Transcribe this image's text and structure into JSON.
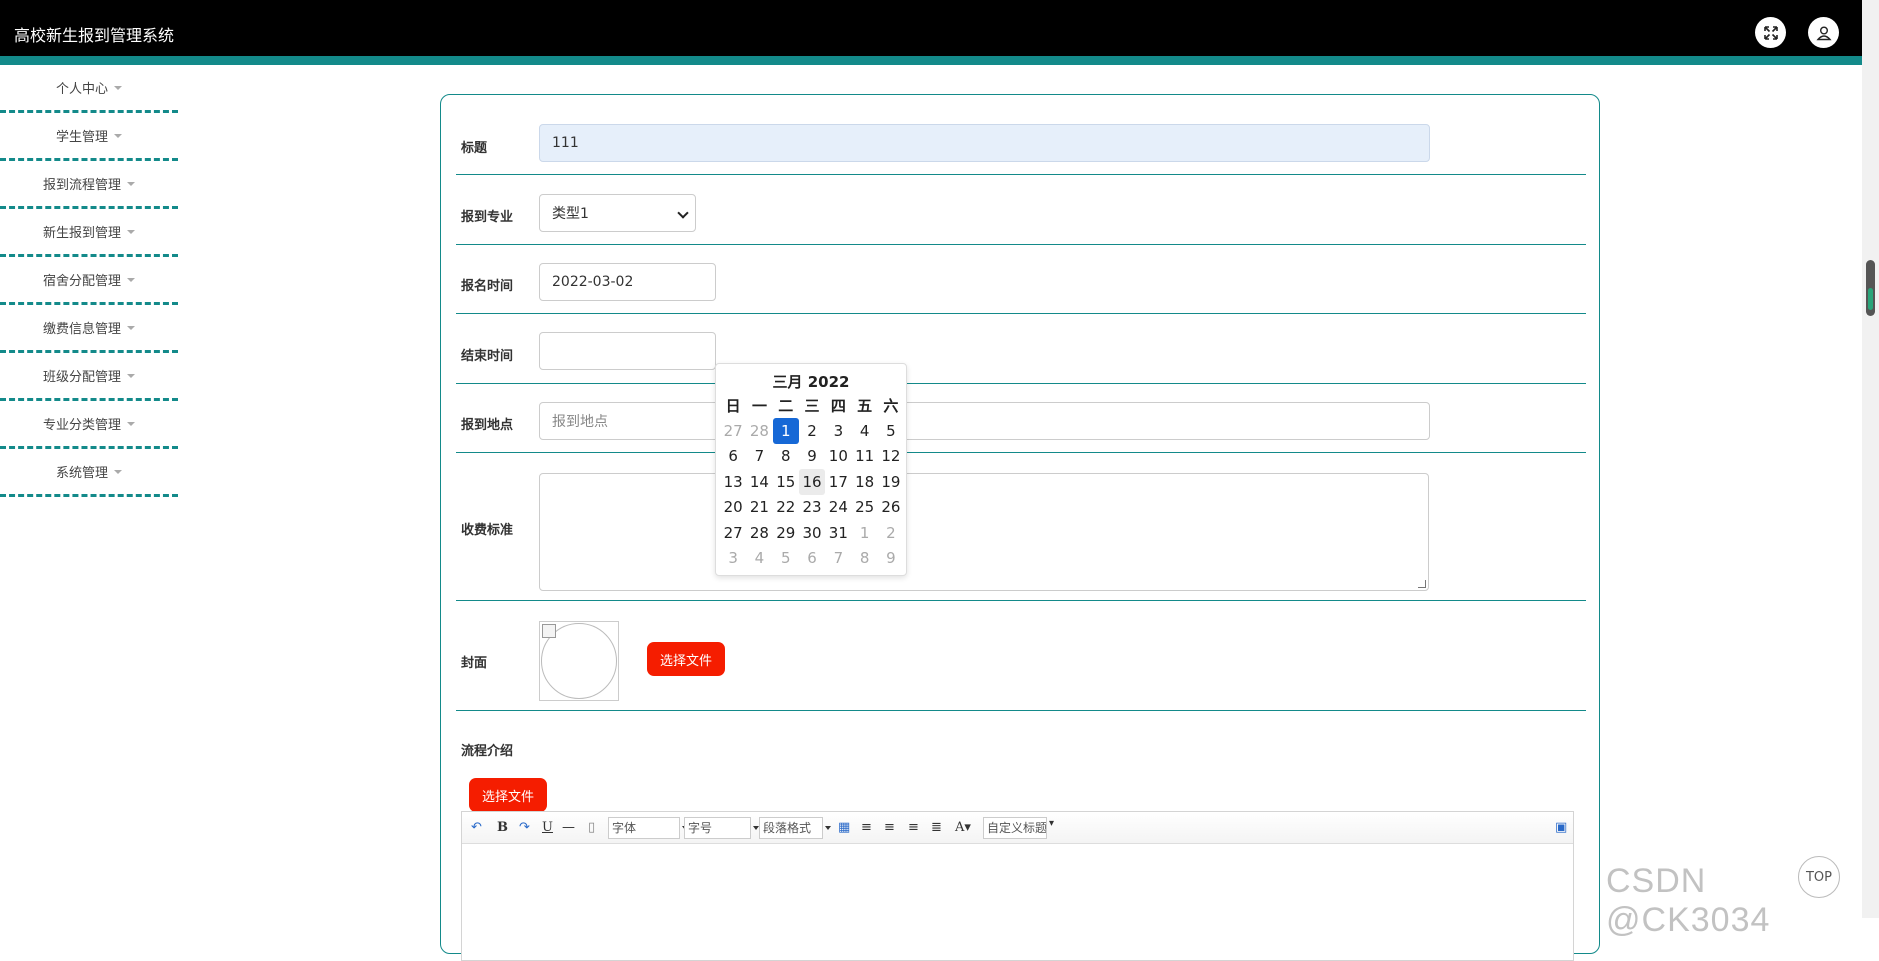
{
  "app": {
    "title": "高校新生报到管理系统"
  },
  "header": {
    "fullscreen_icon": "expand-icon",
    "user_icon": "user-icon"
  },
  "sidebar": {
    "items": [
      {
        "label": "个人中心"
      },
      {
        "label": "学生管理"
      },
      {
        "label": "报到流程管理"
      },
      {
        "label": "新生报到管理"
      },
      {
        "label": "宿舍分配管理"
      },
      {
        "label": "缴费信息管理"
      },
      {
        "label": "班级分配管理"
      },
      {
        "label": "专业分类管理"
      },
      {
        "label": "系统管理"
      }
    ]
  },
  "form": {
    "title": {
      "label": "标题",
      "value": "111"
    },
    "major": {
      "label": "报到专业",
      "value": "类型1"
    },
    "signup_time": {
      "label": "报名时间",
      "value": "2022-03-02"
    },
    "end_time": {
      "label": "结束时间",
      "value": ""
    },
    "location": {
      "label": "报到地点",
      "placeholder": "报到地点"
    },
    "fee": {
      "label": "收费标准",
      "value": ""
    },
    "cover": {
      "label": "封面",
      "button": "选择文件"
    },
    "process": {
      "label": "流程介绍",
      "button": "选择文件"
    }
  },
  "calendar": {
    "header": "三月 2022",
    "weekdays": [
      "日",
      "一",
      "二",
      "三",
      "四",
      "五",
      "六"
    ],
    "weeks": [
      [
        "27",
        "28",
        "1",
        "2",
        "3",
        "4",
        "5"
      ],
      [
        "6",
        "7",
        "8",
        "9",
        "10",
        "11",
        "12"
      ],
      [
        "13",
        "14",
        "15",
        "16",
        "17",
        "18",
        "19"
      ],
      [
        "20",
        "21",
        "22",
        "23",
        "24",
        "25",
        "26"
      ],
      [
        "27",
        "28",
        "29",
        "30",
        "31",
        "1",
        "2"
      ],
      [
        "3",
        "4",
        "5",
        "6",
        "7",
        "8",
        "9"
      ]
    ],
    "selected": "1",
    "hovered": "16"
  },
  "editor": {
    "font_family": "字体",
    "font_size": "字号",
    "paragraph": "段落格式",
    "custom_title": "自定义标题"
  },
  "misc": {
    "top_button": "TOP",
    "watermark": "CSDN @CK3034"
  },
  "colors": {
    "accent": "#138a8a",
    "danger": "#f51d00",
    "selected": "#1668d6"
  }
}
